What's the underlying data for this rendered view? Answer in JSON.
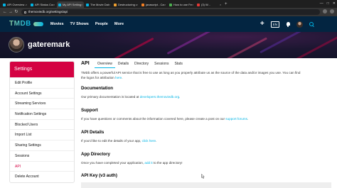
{
  "browser": {
    "tabs": [
      {
        "title": "API Overview —",
        "favicon_color": "#01b4e4",
        "active": false
      },
      {
        "title": "API Status Codes",
        "favicon_color": "#01b4e4",
        "active": false
      },
      {
        "title": "My API Settings",
        "favicon_color": "#01b4e4",
        "active": true
      },
      {
        "title": "The Movie Datab",
        "favicon_color": "#01b4e4",
        "active": false
      },
      {
        "title": "Destructuring a",
        "favicon_color": "#f0a030",
        "active": false
      },
      {
        "title": "javascript - Can",
        "favicon_color": "#f48024",
        "active": false
      },
      {
        "title": "How to use Fetc",
        "favicon_color": "#4caf50",
        "active": false
      },
      {
        "title": "(3) W...",
        "favicon_color": "#e53935",
        "active": false
      }
    ],
    "url": "themoviedb.org/settings/api"
  },
  "nav": {
    "logo_text": "TMDB",
    "links": [
      "Movies",
      "TV Shows",
      "People",
      "More"
    ],
    "add_glyph": "+",
    "lang": "EN"
  },
  "profile": {
    "username": "gateremark"
  },
  "sidebar": {
    "heading": "Settings",
    "items": [
      {
        "label": "Edit Profile",
        "active": false
      },
      {
        "label": "Account Settings",
        "active": false
      },
      {
        "label": "Streaming Services",
        "active": false
      },
      {
        "label": "Notification Settings",
        "active": false
      },
      {
        "label": "Blocked Users",
        "active": false
      },
      {
        "label": "Import List",
        "active": false
      },
      {
        "label": "Sharing Settings",
        "active": false
      },
      {
        "label": "Sessions",
        "active": false
      },
      {
        "label": "API",
        "active": true
      },
      {
        "label": "Delete Account",
        "active": false
      }
    ]
  },
  "main": {
    "title": "API",
    "tabs": [
      {
        "label": "Overview",
        "active": true
      },
      {
        "label": "Details",
        "active": false
      },
      {
        "label": "Directory",
        "active": false
      },
      {
        "label": "Sessions",
        "active": false
      },
      {
        "label": "Stats",
        "active": false
      }
    ],
    "intro_line1": "TMDb offers a powerful API service that is free to use as long as you properly attribute us as the source of the data and/or images you use. You can find",
    "intro_line2": "the logos for attribution",
    "intro_link": "here",
    "intro_end": ".",
    "documentation": {
      "heading": "Documentation",
      "text": "Our primary documentation is located at",
      "link": "developers.themoviedb.org",
      "end": "."
    },
    "support": {
      "heading": "Support",
      "text": "If you have questions or comments about the information covered here, please create a post on our",
      "link": "support forums",
      "end": "."
    },
    "api_details": {
      "heading": "API Details",
      "text": "If you'd like to edit the details of your app,",
      "link": "click here",
      "end": "."
    },
    "app_directory": {
      "heading": "App Directory",
      "text": "Once you have completed your application,",
      "link": "add it",
      "end": "to the app directory!"
    },
    "api_key": {
      "heading": "API Key (v3 auth)"
    }
  },
  "colors": {
    "tmdb_navy": "#032541",
    "tmdb_blue": "#01b4e4",
    "tmdb_green": "#90cea1",
    "settings_red": "#d40242"
  }
}
